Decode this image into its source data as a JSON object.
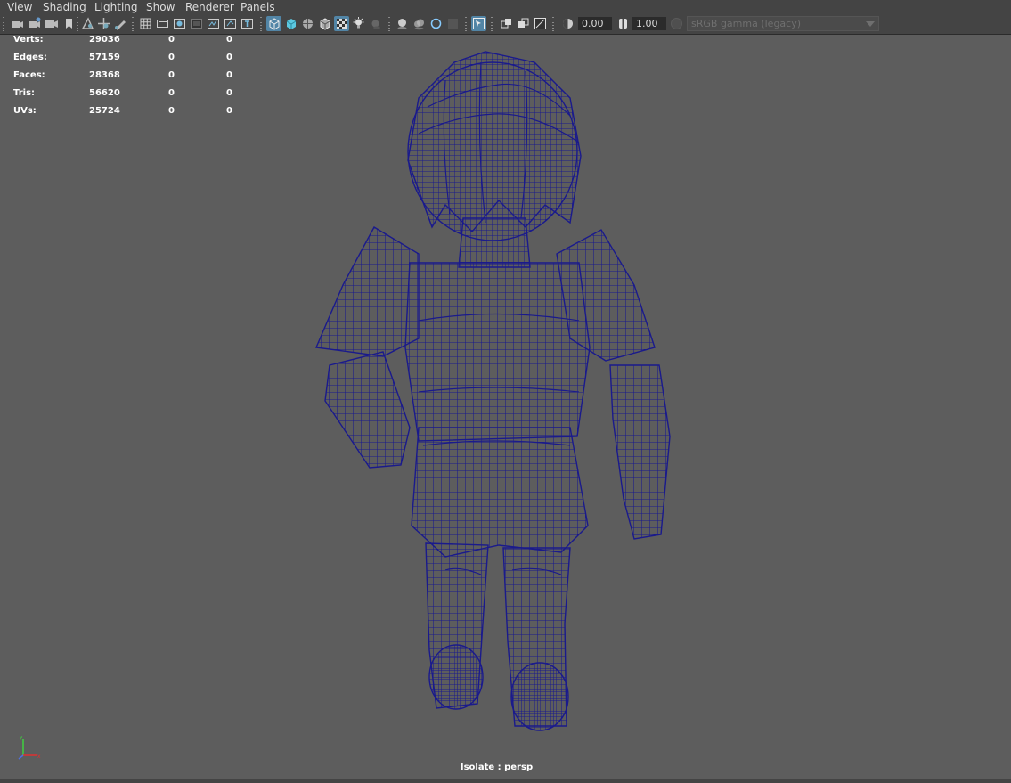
{
  "menu": [
    {
      "id": "view",
      "label": "View"
    },
    {
      "id": "shading",
      "label": "Shading"
    },
    {
      "id": "lighting",
      "label": "Lighting"
    },
    {
      "id": "show",
      "label": "Show"
    },
    {
      "id": "renderer",
      "label": "Renderer"
    },
    {
      "id": "panels",
      "label": "Panels"
    }
  ],
  "toolbar": {
    "exposure_value": "0.00",
    "gamma_value": "1.00",
    "color_space": "sRGB gamma (legacy)",
    "icons": [
      "camera-select-icon",
      "camera-attributes-icon",
      "film-gate-icon",
      "bookmark-icon",
      "image-plane-icon",
      "camera-pan-icon",
      "grease-pencil-icon",
      "grid-icon",
      "film-gate-toggle-icon",
      "resolution-gate-icon",
      "gate-mask-icon",
      "field-chart-icon",
      "safe-action-icon",
      "safe-title-icon",
      "wireframe-icon",
      "smooth-shade-icon",
      "shade-wireframe-icon",
      "wireframe-on-shaded-icon",
      "xray-icon",
      "use-lights-icon",
      "shadows-icon",
      "screen-space-ao-icon",
      "motion-blur-icon",
      "anti-aliasing-icon",
      "depth-of-field-icon",
      "isolate-select-icon",
      "xray-joints-icon",
      "xray-active-icon",
      "backface-icon",
      "exposure-icon",
      "gamma-icon"
    ]
  },
  "hud": {
    "rows": [
      {
        "label": "Verts:",
        "values": [
          "29036",
          "0",
          "0"
        ]
      },
      {
        "label": "Edges:",
        "values": [
          "57159",
          "0",
          "0"
        ]
      },
      {
        "label": "Faces:",
        "values": [
          "28368",
          "0",
          "0"
        ]
      },
      {
        "label": "Tris:",
        "values": [
          "56620",
          "0",
          "0"
        ]
      },
      {
        "label": "UVs:",
        "values": [
          "25724",
          "0",
          "0"
        ]
      }
    ]
  },
  "camera_label": "Isolate : persp",
  "colors": {
    "viewport_bg": "#5d5d5d",
    "toolbar_bg": "#444444",
    "wireframe": "#1a1a8c",
    "active_button": "#5285a6"
  }
}
